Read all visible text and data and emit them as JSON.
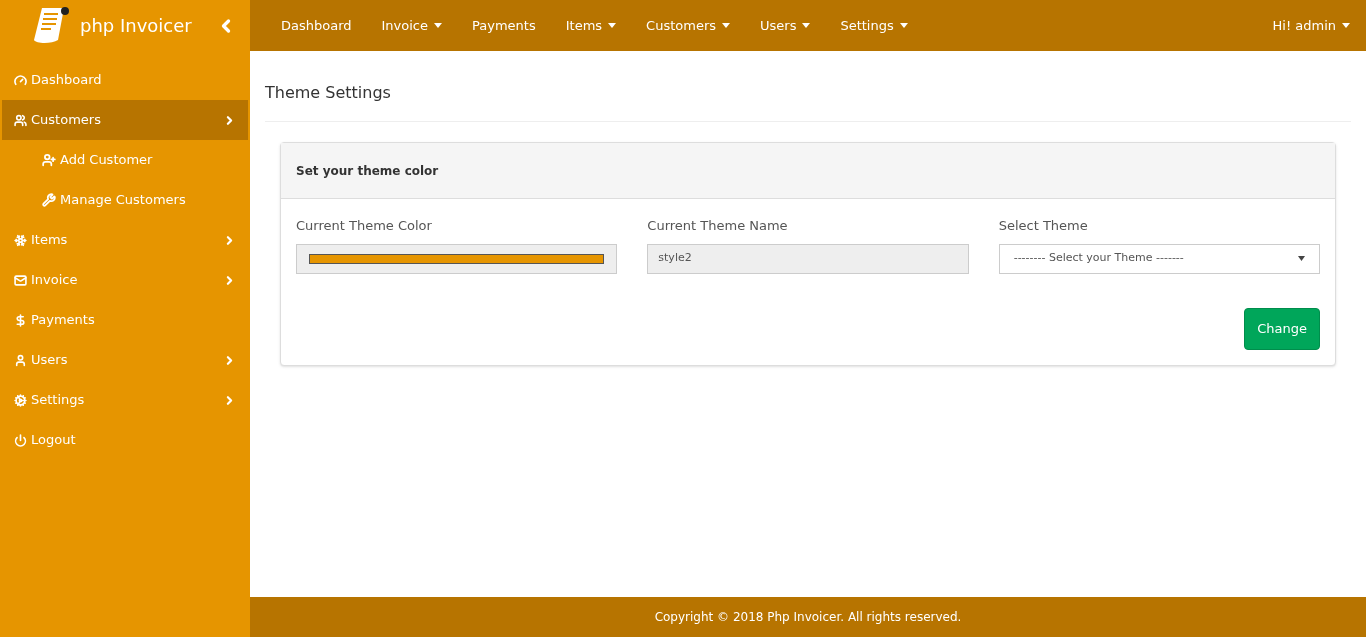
{
  "brand": {
    "name": "php Invoicer"
  },
  "sidebar": {
    "items": [
      {
        "label": "Dashboard",
        "has_submenu": false,
        "selected": false
      },
      {
        "label": "Customers",
        "has_submenu": true,
        "selected": true,
        "children": [
          {
            "label": "Add Customer"
          },
          {
            "label": "Manage Customers"
          }
        ]
      },
      {
        "label": "Items",
        "has_submenu": true,
        "selected": false
      },
      {
        "label": "Invoice",
        "has_submenu": true,
        "selected": false
      },
      {
        "label": "Payments",
        "has_submenu": false,
        "selected": false
      },
      {
        "label": "Users",
        "has_submenu": true,
        "selected": false
      },
      {
        "label": "Settings",
        "has_submenu": true,
        "selected": false
      },
      {
        "label": "Logout",
        "has_submenu": false,
        "selected": false
      }
    ]
  },
  "topnav": {
    "items": [
      {
        "label": "Dashboard",
        "dropdown": false
      },
      {
        "label": "Invoice",
        "dropdown": true
      },
      {
        "label": "Payments",
        "dropdown": false
      },
      {
        "label": "Items",
        "dropdown": true
      },
      {
        "label": "Customers",
        "dropdown": true
      },
      {
        "label": "Users",
        "dropdown": true
      },
      {
        "label": "Settings",
        "dropdown": true
      }
    ],
    "user": {
      "label": "Hi! admin",
      "dropdown": true
    }
  },
  "page": {
    "title": "Theme Settings"
  },
  "panel": {
    "heading": "Set your theme color",
    "fields": [
      {
        "kind": "swatch",
        "label": "Current Theme Color",
        "color": "#e69500"
      },
      {
        "kind": "text",
        "label": "Current Theme Name",
        "value": "style2"
      },
      {
        "kind": "select",
        "label": "Select Theme",
        "value": "-------- Select your Theme -------"
      }
    ],
    "button": "Change"
  },
  "footer": {
    "text": "Copyright © 2018 Php Invoicer. All rights reserved."
  }
}
